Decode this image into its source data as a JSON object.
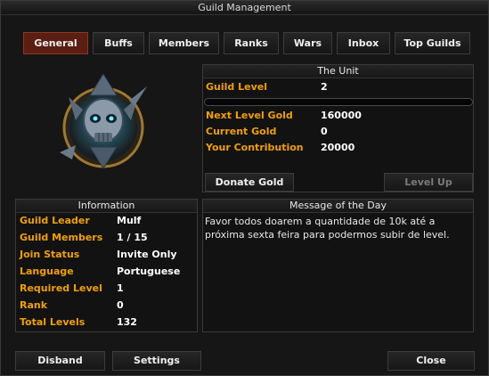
{
  "window": {
    "title": "Guild Management"
  },
  "tabs": [
    {
      "label": "General",
      "active": true
    },
    {
      "label": "Buffs"
    },
    {
      "label": "Members"
    },
    {
      "label": "Ranks"
    },
    {
      "label": "Wars"
    },
    {
      "label": "Inbox"
    },
    {
      "label": "Top Guilds"
    }
  ],
  "emblem": {
    "icon": "skull-emblem-icon"
  },
  "unit": {
    "header": "The Unit",
    "guild_level_label": "Guild Level",
    "guild_level_value": "2",
    "progress_fraction": 0.0,
    "next_level_gold_label": "Next Level Gold",
    "next_level_gold_value": "160000",
    "current_gold_label": "Current Gold",
    "current_gold_value": "0",
    "contribution_label": "Your Contribution",
    "contribution_value": "20000",
    "donate_label": "Donate Gold",
    "level_up_label": "Level Up"
  },
  "info": {
    "header": "Information",
    "rows": [
      {
        "label": "Guild Leader",
        "value": "Mulf"
      },
      {
        "label": "Guild Members",
        "value": "1 / 15"
      },
      {
        "label": "Join Status",
        "value": "Invite Only"
      },
      {
        "label": "Language",
        "value": "Portuguese"
      },
      {
        "label": "Required Level",
        "value": "1"
      },
      {
        "label": "Rank",
        "value": "0"
      },
      {
        "label": "Total Levels",
        "value": "132"
      }
    ]
  },
  "motd": {
    "header": "Message of the Day",
    "text": "Favor todos doarem a quantidade de 10k até a próxima sexta feira para podermos subir de level."
  },
  "footer": {
    "disband_label": "Disband",
    "settings_label": "Settings",
    "close_label": "Close"
  },
  "colors": {
    "label": "#f0a000",
    "active_tab": "#5a1e12"
  }
}
